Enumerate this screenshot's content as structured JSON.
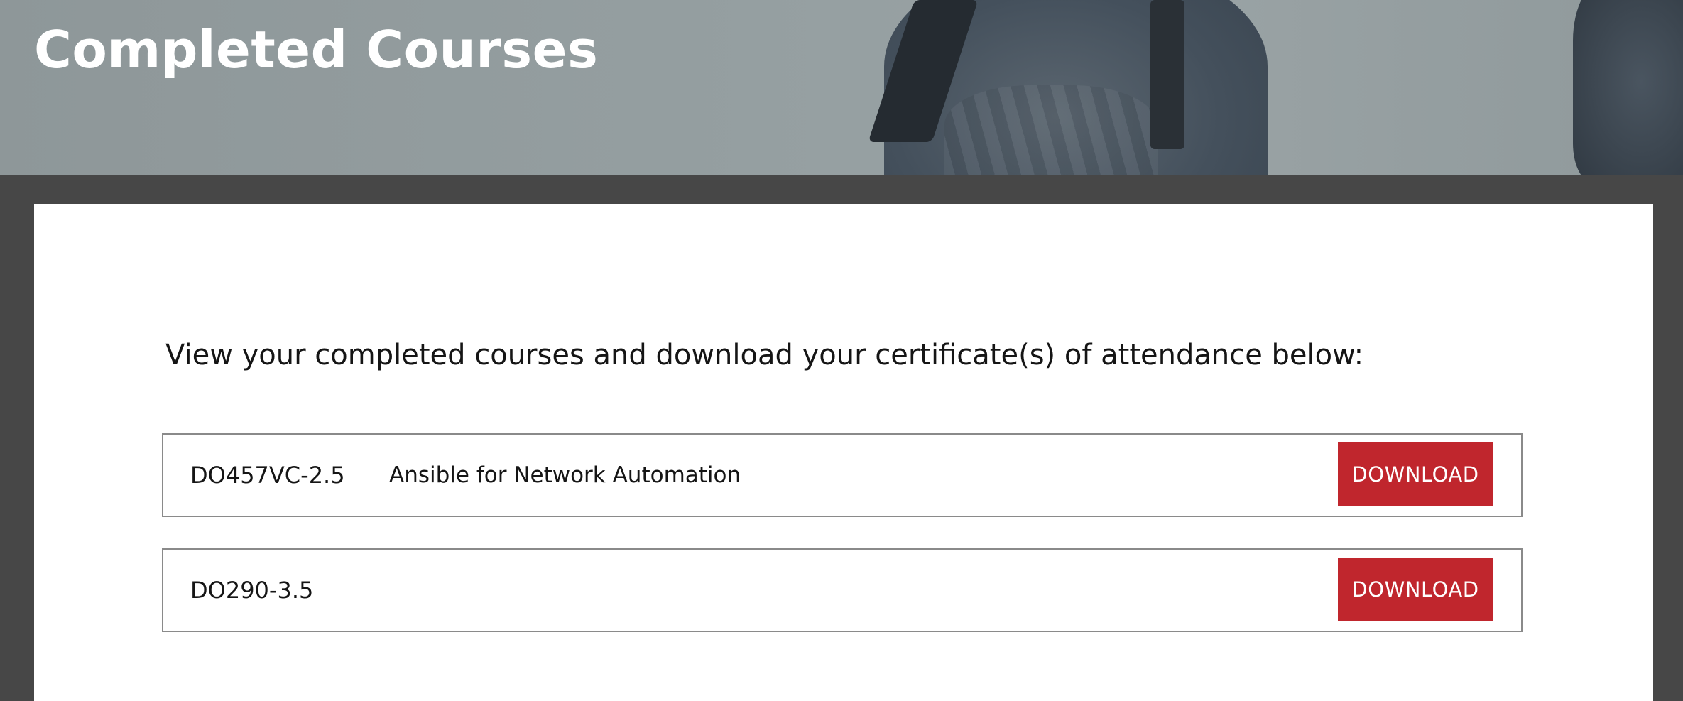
{
  "header": {
    "title": "Completed Courses"
  },
  "main": {
    "intro_text": "View your completed courses and download your certificate(s) of attendance below:",
    "courses": [
      {
        "code": "DO457VC-2.5",
        "name": "Ansible for Network Automation",
        "button_label": "DOWNLOAD"
      },
      {
        "code": "DO290-3.5",
        "name": "",
        "button_label": "DOWNLOAD"
      }
    ]
  },
  "colors": {
    "accent_button": "#c0262d",
    "page_background": "#474747",
    "card_background": "#ffffff"
  }
}
